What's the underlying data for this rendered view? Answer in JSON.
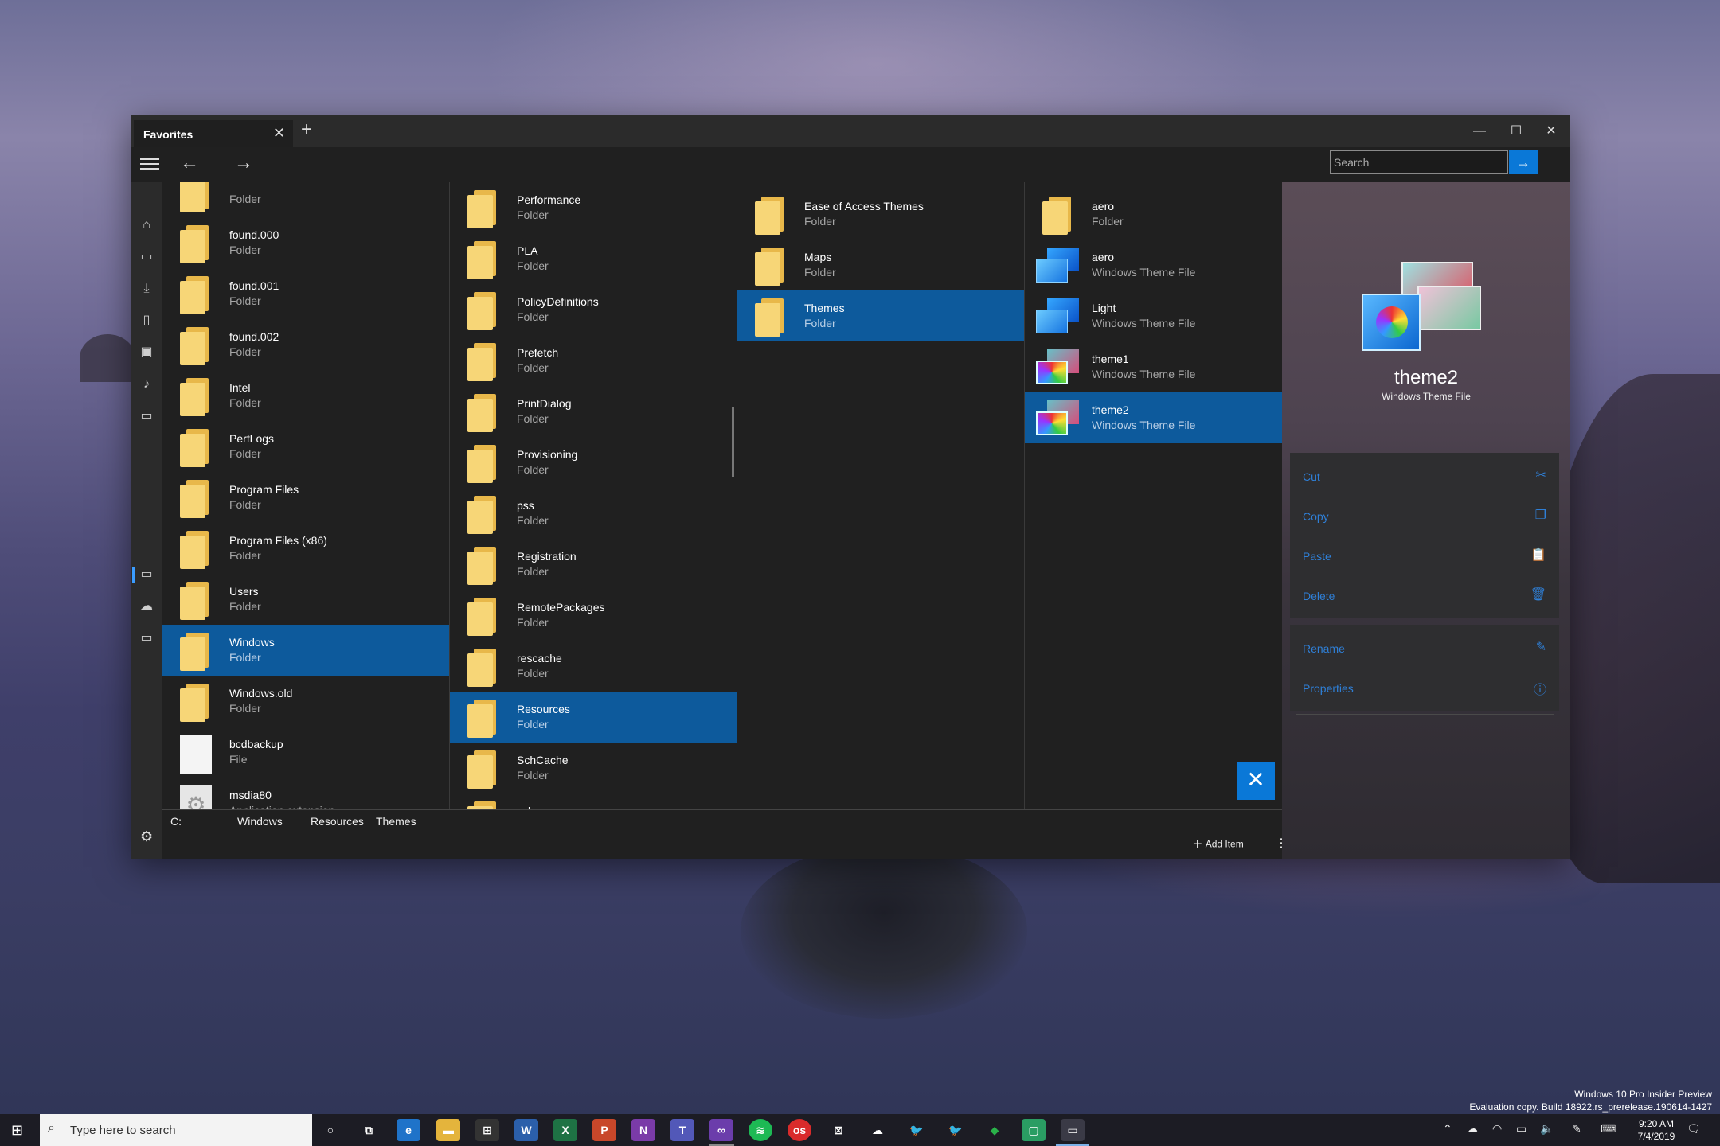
{
  "window": {
    "tab_title": "Favorites",
    "tab_close": "✕",
    "tab_add": "+",
    "minimize": "—",
    "maximize": "☐",
    "close": "✕"
  },
  "toolbar": {
    "back": "←",
    "forward": "→",
    "search_placeholder": "Search",
    "search_go": "→"
  },
  "columns": [
    {
      "items": [
        {
          "name": "",
          "type": "Folder",
          "icon": "folder"
        },
        {
          "name": "found.000",
          "type": "Folder",
          "icon": "folder"
        },
        {
          "name": "found.001",
          "type": "Folder",
          "icon": "folder"
        },
        {
          "name": "found.002",
          "type": "Folder",
          "icon": "folder"
        },
        {
          "name": "Intel",
          "type": "Folder",
          "icon": "folder"
        },
        {
          "name": "PerfLogs",
          "type": "Folder",
          "icon": "folder"
        },
        {
          "name": "Program Files",
          "type": "Folder",
          "icon": "folder"
        },
        {
          "name": "Program Files (x86)",
          "type": "Folder",
          "icon": "folder"
        },
        {
          "name": "Users",
          "type": "Folder",
          "icon": "folder"
        },
        {
          "name": "Windows",
          "type": "Folder",
          "icon": "folder",
          "selected": true
        },
        {
          "name": "Windows.old",
          "type": "Folder",
          "icon": "folder"
        },
        {
          "name": "bcdbackup",
          "type": "File",
          "icon": "file"
        },
        {
          "name": "msdia80",
          "type": "Application extension",
          "icon": "gear-file"
        }
      ]
    },
    {
      "items": [
        {
          "name": "Performance",
          "type": "Folder",
          "icon": "folder"
        },
        {
          "name": "PLA",
          "type": "Folder",
          "icon": "folder"
        },
        {
          "name": "PolicyDefinitions",
          "type": "Folder",
          "icon": "folder"
        },
        {
          "name": "Prefetch",
          "type": "Folder",
          "icon": "folder"
        },
        {
          "name": "PrintDialog",
          "type": "Folder",
          "icon": "folder"
        },
        {
          "name": "Provisioning",
          "type": "Folder",
          "icon": "folder"
        },
        {
          "name": "pss",
          "type": "Folder",
          "icon": "folder"
        },
        {
          "name": "Registration",
          "type": "Folder",
          "icon": "folder"
        },
        {
          "name": "RemotePackages",
          "type": "Folder",
          "icon": "folder"
        },
        {
          "name": "rescache",
          "type": "Folder",
          "icon": "folder"
        },
        {
          "name": "Resources",
          "type": "Folder",
          "icon": "folder",
          "selected": true
        },
        {
          "name": "SchCache",
          "type": "Folder",
          "icon": "folder"
        },
        {
          "name": "schemas",
          "type": "",
          "icon": "folder"
        }
      ]
    },
    {
      "items": [
        {
          "name": "Ease of Access Themes",
          "type": "Folder",
          "icon": "folder"
        },
        {
          "name": "Maps",
          "type": "Folder",
          "icon": "folder"
        },
        {
          "name": "Themes",
          "type": "Folder",
          "icon": "folder",
          "selected": true
        }
      ]
    },
    {
      "items": [
        {
          "name": "aero",
          "type": "Folder",
          "icon": "folder"
        },
        {
          "name": "aero",
          "type": "Windows Theme File",
          "icon": "theme"
        },
        {
          "name": "Light",
          "type": "Windows Theme File",
          "icon": "theme"
        },
        {
          "name": "theme1",
          "type": "Windows Theme File",
          "icon": "theme-pic"
        },
        {
          "name": "theme2",
          "type": "Windows Theme File",
          "icon": "theme-pic",
          "selected": true
        }
      ]
    }
  ],
  "breadcrumb": [
    "C:",
    "Windows",
    "Resources",
    "Themes"
  ],
  "bottom": {
    "add_item": "Add Item"
  },
  "preview": {
    "title": "theme2",
    "subtitle": "Windows Theme File"
  },
  "actions": [
    {
      "label": "Cut",
      "icon": "✂"
    },
    {
      "label": "Copy",
      "icon": "❐"
    },
    {
      "label": "Paste",
      "icon": "📋"
    },
    {
      "label": "Delete",
      "icon": "🗑"
    },
    {
      "label": "Rename",
      "icon": "✎"
    },
    {
      "label": "Properties",
      "icon": "ⓘ"
    }
  ],
  "desktop": {
    "edition": "Windows 10 Pro Insider Preview",
    "build": "Evaluation copy. Build 18922.rs_prerelease.190614-1427"
  },
  "taskbar": {
    "search_placeholder": "Type here to search",
    "time": "9:20 AM",
    "date": "7/4/2019"
  },
  "colors": {
    "accent": "#0a78d7",
    "selection": "#0d5a9c",
    "action_text": "#2f7fd6",
    "folder": "#f7d677"
  }
}
